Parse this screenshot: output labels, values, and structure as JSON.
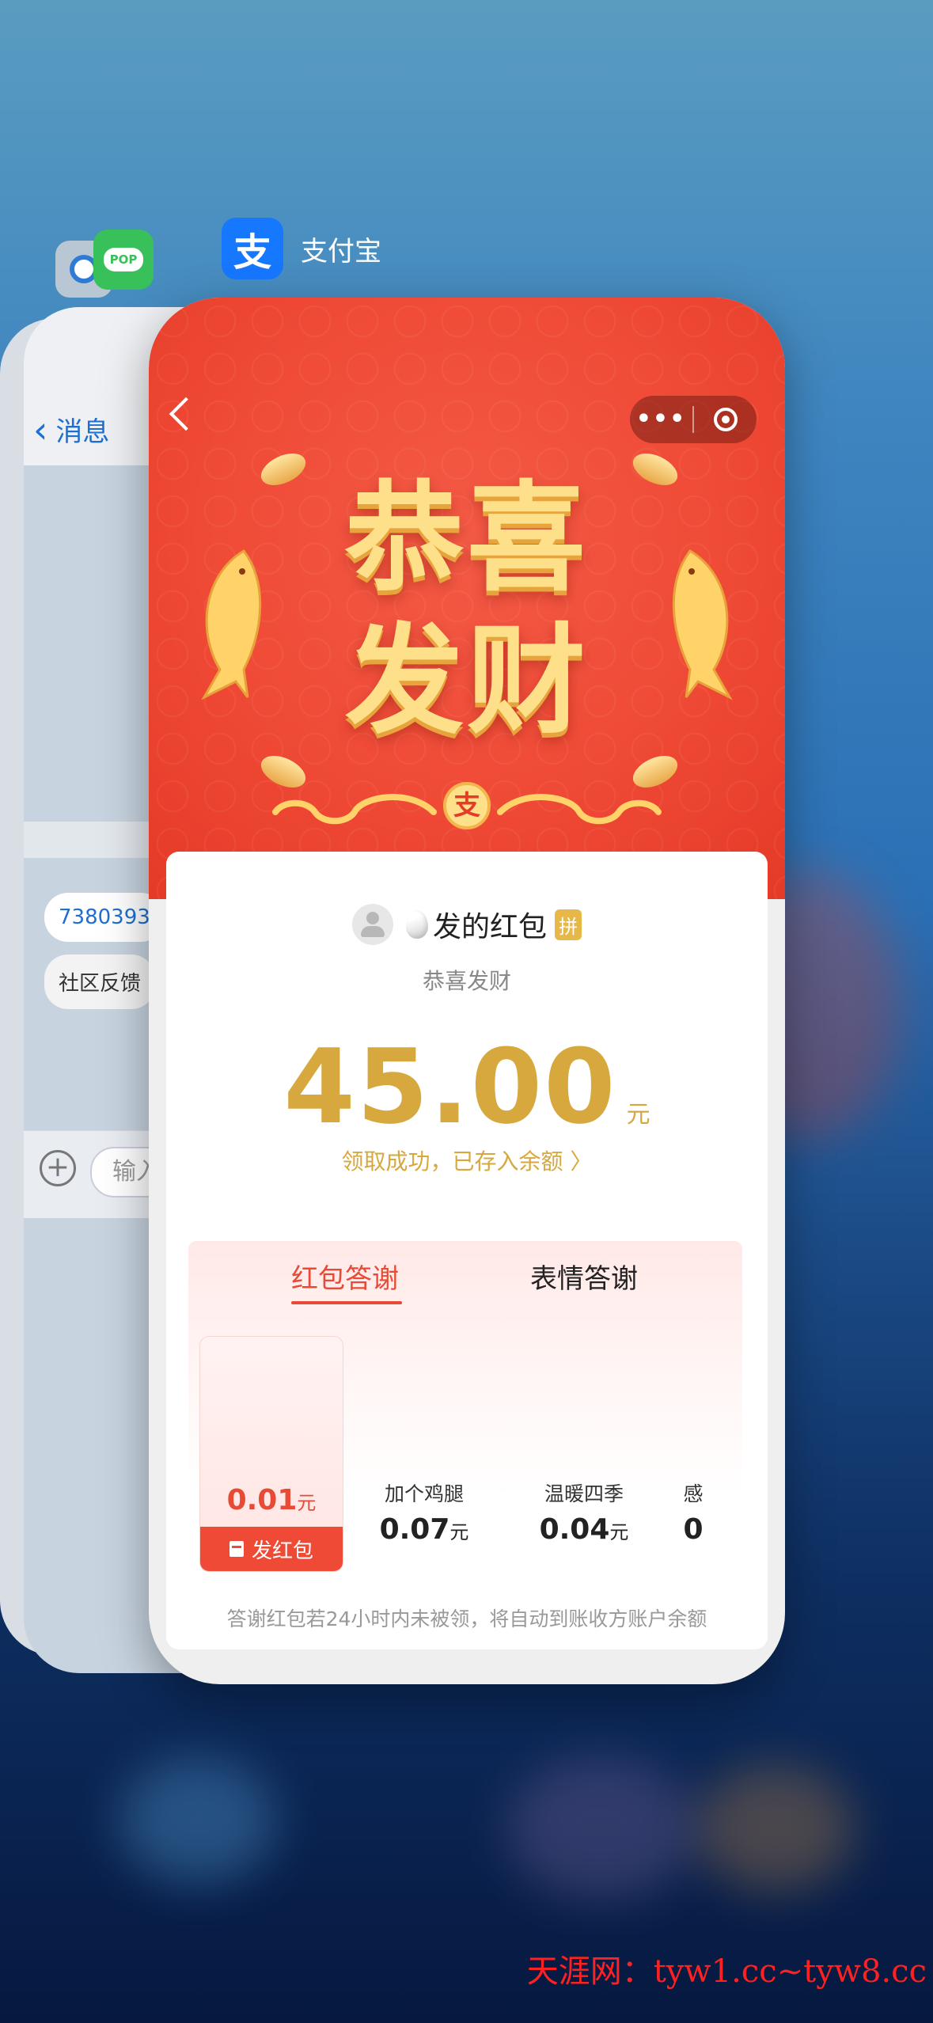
{
  "switcher": {
    "front_app_name": "支付宝",
    "front_app_icon": "alipay-icon",
    "front_app_icon_glyph": "支",
    "other_icons": [
      "chrome-icon",
      "pop-icon"
    ],
    "pop_label": "POP"
  },
  "back_card": {
    "back_label": "消息",
    "bubbles": [
      "7380393",
      "社区反馈"
    ],
    "input_placeholder": "输入"
  },
  "redpacket": {
    "blessing_line1": "恭喜",
    "blessing_line2": "发财",
    "badge_glyph": "支",
    "sender_suffix": "发的红包",
    "pin_label": "拼",
    "subtitle": "恭喜发财",
    "amount": "45.00",
    "amount_unit": "元",
    "status": "领取成功，已存入余额 〉",
    "tabs": [
      "红包答谢",
      "表情答谢"
    ],
    "active_tab": 0,
    "gift": {
      "amount": "0.01",
      "unit": "元",
      "button_label": "发红包"
    },
    "options": [
      {
        "name": "加个鸡腿",
        "value": "0.07",
        "unit": "元"
      },
      {
        "name": "温暖四季",
        "value": "0.04",
        "unit": "元"
      },
      {
        "name": "感",
        "value": "0",
        "unit": ""
      }
    ],
    "footnote": "答谢红包若24小时内未被领，将自动到账收方账户余额"
  },
  "watermark": "天涯网：tyw1.cc~tyw8.cc",
  "colors": {
    "red": "#ef4a36",
    "gold": "#d6a83e",
    "blue": "#1677ff"
  }
}
